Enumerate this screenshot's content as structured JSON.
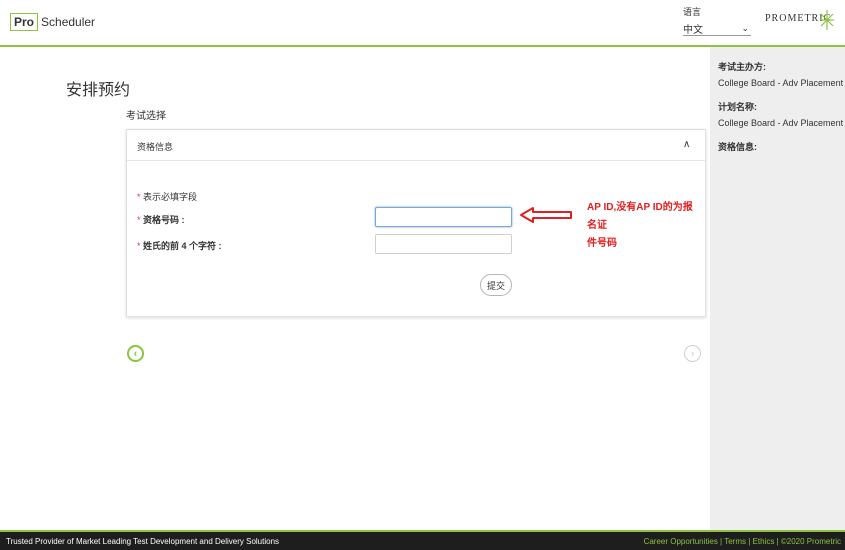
{
  "header": {
    "logo_pro": "Pro",
    "logo_scheduler": "Scheduler",
    "language_label": "语言",
    "language_value": "中文",
    "brand": "PROMETRIC"
  },
  "sidebar": {
    "sponsor_label": "考试主办方:",
    "sponsor_value": "College Board - Adv Placement",
    "program_label": "计划名称:",
    "program_value": "College Board - Adv Placement",
    "eligibility_label": "资格信息:"
  },
  "main": {
    "page_title": "安排预约",
    "section_label": "考试选择",
    "panel_title": "资格信息",
    "required_note": "表示必填字段",
    "field1_label": "资格号码 :",
    "field1_value": "",
    "field2_label": "姓氏的前 4 个字符 :",
    "field2_value": "",
    "submit_label": "提交",
    "required_star": "*"
  },
  "annotation": {
    "line1": "AP ID,没有AP ID的为报名证",
    "line2": "件号码",
    "color": "#e02020"
  },
  "footer": {
    "left_text": "Trusted Provider of Market Leading Test Development and Delivery Solutions",
    "link_careers": "Career Opportunities",
    "link_terms": "Terms",
    "link_ethics": "Ethics",
    "copyright": "©2020 Prometric",
    "separator": " | "
  },
  "colors": {
    "accent": "#8cc43f",
    "footer_bg": "#1e1e1e",
    "sidebar_bg": "#eeeeee"
  }
}
